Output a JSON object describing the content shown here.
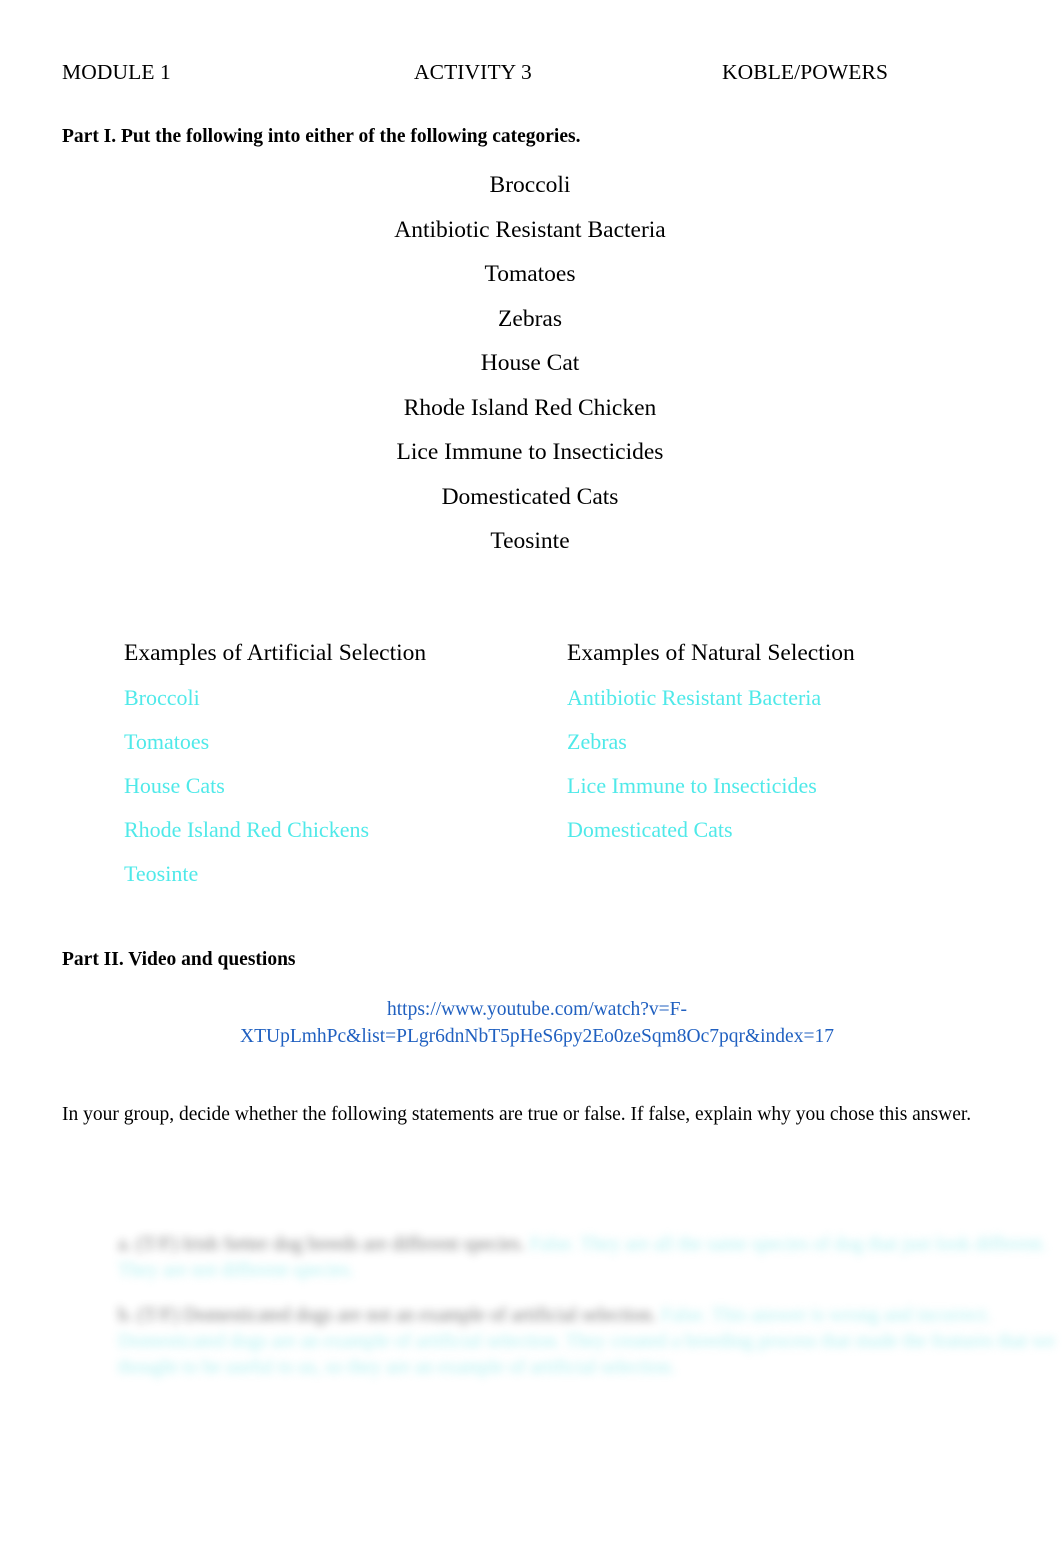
{
  "header": {
    "module": "MODULE 1",
    "activity": "ACTIVITY 3",
    "authors": "KOBLE/POWERS"
  },
  "part_one": {
    "heading": "Part I. Put the following into either of the following categories.",
    "terms": [
      "Broccoli",
      "Antibiotic Resistant Bacteria",
      "Tomatoes",
      "Zebras",
      "House Cat",
      "Rhode Island Red Chicken",
      "Lice Immune to Insecticides",
      "Domesticated Cats",
      "Teosinte"
    ],
    "columns": [
      {
        "title": "Examples of Artificial Selection",
        "answers": [
          "Broccoli",
          "Tomatoes",
          "House Cats",
          "Rhode Island Red Chickens",
          "Teosinte"
        ]
      },
      {
        "title": "Examples of Natural Selection",
        "answers": [
          "Antibiotic Resistant Bacteria",
          "Zebras",
          "Lice Immune to Insecticides",
          "Domesticated Cats"
        ]
      }
    ]
  },
  "part_two": {
    "heading": "Part II. Video and questions",
    "video_url": "https://www.youtube.com/watch?v=F-XTUpLmhPc&list=PLgr6dnNbT5pHeS6py2Eo0zeSqm8Oc7pqr&index=17",
    "instructions": "In your group, decide whether the following statements are true or false. If false, explain why you chose this answer.",
    "questions": [
      {
        "prompt": "a. (T/F) Irish Setter dog breeds are different species.",
        "answer": "False. They are all the same species of dog that just look different. They are not different species.",
        "answer_wrap": "are not different species. They are not different species."
      },
      {
        "prompt": "b. (T/F) Domesticated dogs are not an example of artificial selection.",
        "answer": "False. This answer is wrong and incorrect. Domesticated dogs are an example of artificial selection. They created a breeding process that made the features that we thought to be useful to us, so they are an example of artificial selection.",
        "answer_wrap": "are an example of artificial selection."
      }
    ]
  },
  "colors": {
    "answer_teal": "#4FE9E9",
    "link_blue": "#2060C0",
    "text_black": "#000000",
    "page_background": "#FFFFFF"
  }
}
